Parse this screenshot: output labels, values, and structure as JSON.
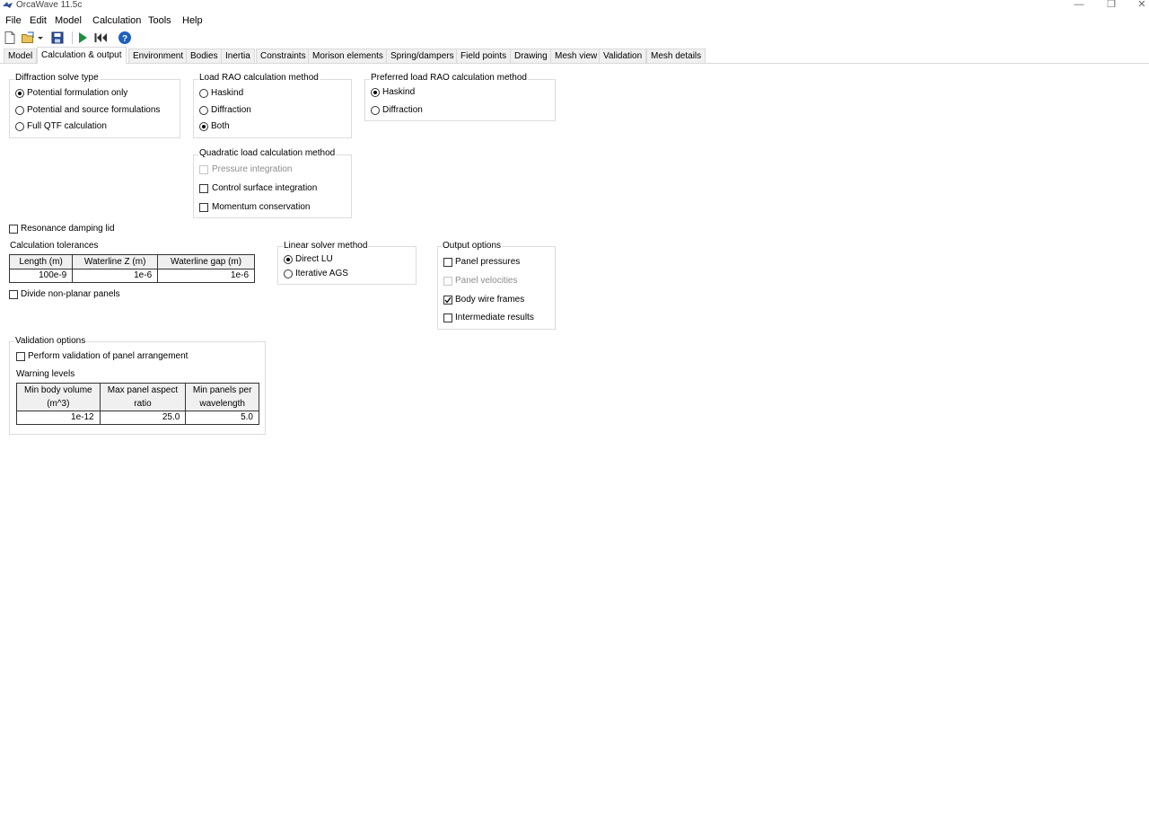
{
  "window": {
    "title": "OrcaWave 11.5c",
    "controls": {
      "minimize": "—",
      "restore": "❐",
      "close": "✕"
    }
  },
  "menu": [
    "File",
    "Edit",
    "Model",
    "Calculation",
    "Tools",
    "Help"
  ],
  "toolbar": {
    "icons": [
      "new-file-icon",
      "open-folder-icon",
      "dropdown-arrow-icon",
      "save-icon",
      "run-calculation-icon",
      "reset-icon",
      "help-icon"
    ],
    "colors": {
      "run": "#1a8f3c",
      "help": "#1d5fbf",
      "save": "#2b4e9b"
    }
  },
  "tabs": [
    "Model",
    "Calculation & output",
    "Environment",
    "Bodies",
    "Inertia",
    "Constraints",
    "Morison elements",
    "Spring/dampers",
    "Field points",
    "Drawing",
    "Mesh view",
    "Validation",
    "Mesh details"
  ],
  "active_tab": "Calculation & output",
  "diffraction_solve_type": {
    "title": "Diffraction solve type",
    "options": [
      "Potential formulation only",
      "Potential and source formulations",
      "Full QTF calculation"
    ],
    "selected": "Potential formulation only"
  },
  "load_rao_method": {
    "title": "Load RAO calculation method",
    "options": [
      "Haskind",
      "Diffraction",
      "Both"
    ],
    "selected": "Both"
  },
  "preferred_load_rao_method": {
    "title": "Preferred load RAO calculation method",
    "options": [
      "Haskind",
      "Diffraction"
    ],
    "selected": "Haskind"
  },
  "quadratic_load_method": {
    "title": "Quadratic load calculation method",
    "options": [
      {
        "label": "Pressure integration",
        "checked": false,
        "enabled": false
      },
      {
        "label": "Control surface integration",
        "checked": false,
        "enabled": true
      },
      {
        "label": "Momentum conservation",
        "checked": false,
        "enabled": true
      }
    ]
  },
  "resonance_damping_lid": {
    "label": "Resonance damping lid",
    "checked": false
  },
  "calculation_tolerances": {
    "title": "Calculation tolerances",
    "headers": [
      "Length (m)",
      "Waterline Z (m)",
      "Waterline gap (m)"
    ],
    "values": [
      "100e-9",
      "1e-6",
      "1e-6"
    ]
  },
  "divide_non_planar_panels": {
    "label": "Divide non-planar panels",
    "checked": false
  },
  "linear_solver_method": {
    "title": "Linear solver method",
    "options": [
      "Direct LU",
      "Iterative AGS"
    ],
    "selected": "Direct LU"
  },
  "output_options": {
    "title": "Output options",
    "options": [
      {
        "label": "Panel pressures",
        "checked": false,
        "enabled": true
      },
      {
        "label": "Panel velocities",
        "checked": false,
        "enabled": false
      },
      {
        "label": "Body wire frames",
        "checked": true,
        "enabled": true
      },
      {
        "label": "Intermediate results",
        "checked": false,
        "enabled": true
      }
    ]
  },
  "validation_options": {
    "title": "Validation options",
    "perform_validation": {
      "label": "Perform validation of panel arrangement",
      "checked": false
    },
    "warning_levels_label": "Warning levels",
    "headers": [
      [
        "Min body volume",
        "(m^3)"
      ],
      [
        "Max panel aspect",
        "ratio"
      ],
      [
        "Min panels per",
        "wavelength"
      ]
    ],
    "values": [
      "1e-12",
      "25.0",
      "5.0"
    ]
  }
}
